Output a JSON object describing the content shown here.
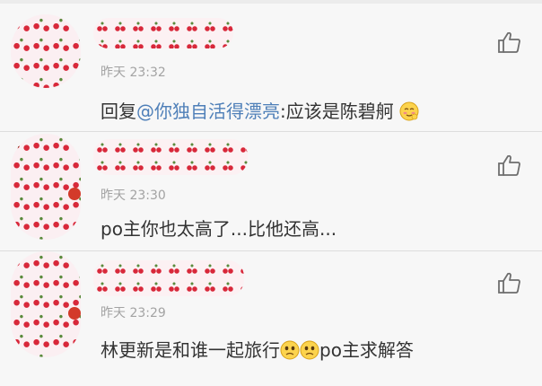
{
  "comments": [
    {
      "time": "昨天 23:32",
      "reply_prefix": "回复",
      "mention": "@你独自活得漂亮",
      "text": ":应该是陈碧舸",
      "emojis": [
        "blush-emoji"
      ]
    },
    {
      "time": "昨天 23:30",
      "text": "po主你也太高了...比他还高...",
      "emojis": []
    },
    {
      "time": "昨天 23:29",
      "text_before": "林更新是和谁一起旅行",
      "text_after": "po主求解答",
      "emojis": [
        "sad-emoji",
        "sad-emoji"
      ]
    }
  ],
  "colors": {
    "mention": "#4e7fb8",
    "body_text": "#333333",
    "time_text": "#a3a3a3",
    "background": "#f7f7f7"
  },
  "icons": [
    "like-thumb-icon"
  ]
}
